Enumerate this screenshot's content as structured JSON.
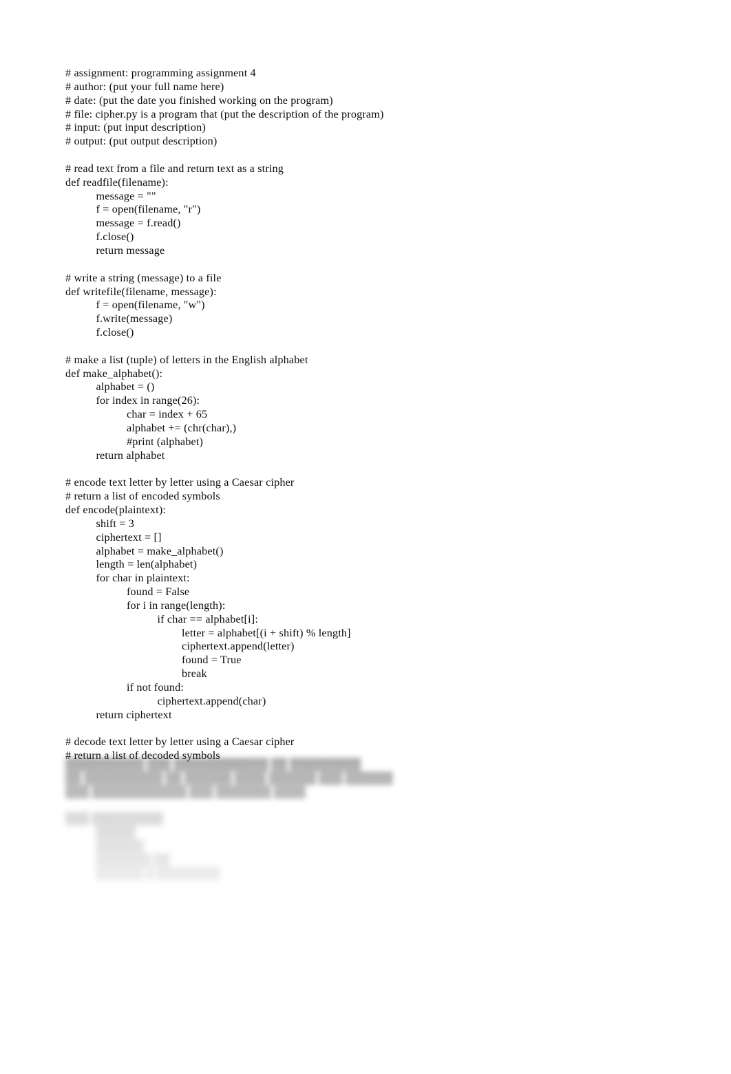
{
  "document": {
    "kind": "python-source-listing",
    "background_color": "#ffffff",
    "text_color": "#0b0b0b",
    "lines": [
      {
        "indent": 0,
        "text": "# assignment: programming assignment 4"
      },
      {
        "indent": 0,
        "text": "# author: (put your full name here)"
      },
      {
        "indent": 0,
        "text": "# date: (put the date you finished working on the program)"
      },
      {
        "indent": 0,
        "text": "# file: cipher.py is a program that (put the description of the program)"
      },
      {
        "indent": 0,
        "text": "# input: (put input description)"
      },
      {
        "indent": 0,
        "text": "# output: (put output description)"
      },
      {
        "indent": 0,
        "text": ""
      },
      {
        "indent": 0,
        "text": "# read text from a file and return text as a string"
      },
      {
        "indent": 0,
        "text": "def readfile(filename):"
      },
      {
        "indent": 1,
        "text": "message = \"\""
      },
      {
        "indent": 1,
        "text": "f = open(filename, \"r\")"
      },
      {
        "indent": 1,
        "text": "message = f.read()"
      },
      {
        "indent": 1,
        "text": "f.close()"
      },
      {
        "indent": 1,
        "text": "return message"
      },
      {
        "indent": 0,
        "text": ""
      },
      {
        "indent": 0,
        "text": "# write a string (message) to a file"
      },
      {
        "indent": 0,
        "text": "def writefile(filename, message):"
      },
      {
        "indent": 1,
        "text": "f = open(filename, \"w\")"
      },
      {
        "indent": 1,
        "text": "f.write(message)"
      },
      {
        "indent": 1,
        "text": "f.close()"
      },
      {
        "indent": 0,
        "text": ""
      },
      {
        "indent": 0,
        "text": "# make a list (tuple) of letters in the English alphabet"
      },
      {
        "indent": 0,
        "text": "def make_alphabet():"
      },
      {
        "indent": 1,
        "text": "alphabet = ()"
      },
      {
        "indent": 1,
        "text": "for index in range(26):"
      },
      {
        "indent": 2,
        "text": "char = index + 65"
      },
      {
        "indent": 2,
        "text": "alphabet += (chr(char),)"
      },
      {
        "indent": 2,
        "text": "#print (alphabet)"
      },
      {
        "indent": 1,
        "text": "return alphabet"
      },
      {
        "indent": 0,
        "text": ""
      },
      {
        "indent": 0,
        "text": "# encode text letter by letter using a Caesar cipher"
      },
      {
        "indent": 0,
        "text": "# return a list of encoded symbols"
      },
      {
        "indent": 0,
        "text": "def encode(plaintext):"
      },
      {
        "indent": 1,
        "text": "shift = 3"
      },
      {
        "indent": 1,
        "text": "ciphertext = []"
      },
      {
        "indent": 1,
        "text": "alphabet = make_alphabet()"
      },
      {
        "indent": 1,
        "text": "length = len(alphabet)"
      },
      {
        "indent": 1,
        "text": "for char in plaintext:"
      },
      {
        "indent": 2,
        "text": "found = False"
      },
      {
        "indent": 2,
        "text": "for i in range(length):"
      },
      {
        "indent": 3,
        "text": "if char == alphabet[i]:"
      },
      {
        "indent": 4,
        "text": "letter = alphabet[(i + shift) % length]"
      },
      {
        "indent": 4,
        "text": "ciphertext.append(letter)"
      },
      {
        "indent": 4,
        "text": "found = True"
      },
      {
        "indent": 4,
        "text": "break"
      },
      {
        "indent": 2,
        "text": "if not found:"
      },
      {
        "indent": 3,
        "text": "ciphertext.append(char)"
      },
      {
        "indent": 1,
        "text": "return ciphertext"
      },
      {
        "indent": 0,
        "text": ""
      },
      {
        "indent": 0,
        "text": "# decode text letter by letter using a Caesar cipher"
      },
      {
        "indent": 0,
        "text": "# return a list of decoded symbols"
      }
    ],
    "obscured_tail": {
      "note": "illegible",
      "blocks": [
        {
          "id": "block-1",
          "lines": [
            {
              "indent": 0,
              "text": "██████████ ███ ████████████ ██ █████████"
            },
            {
              "indent": 0,
              "text": "██ ██████████ ██ ██████ ████ ██████ ███ ██████"
            },
            {
              "indent": 0,
              "text": "███ ████████████ ███ ███████ ████"
            }
          ]
        },
        {
          "id": "block-2",
          "lines": [
            {
              "indent": 0,
              "text": "███ █████████"
            },
            {
              "indent": 1,
              "text": "█████"
            },
            {
              "indent": 1,
              "text": "██████"
            },
            {
              "indent": 1,
              "text": "███████ ██"
            },
            {
              "indent": 1,
              "text": "██████ █ ████████"
            }
          ]
        }
      ]
    }
  }
}
